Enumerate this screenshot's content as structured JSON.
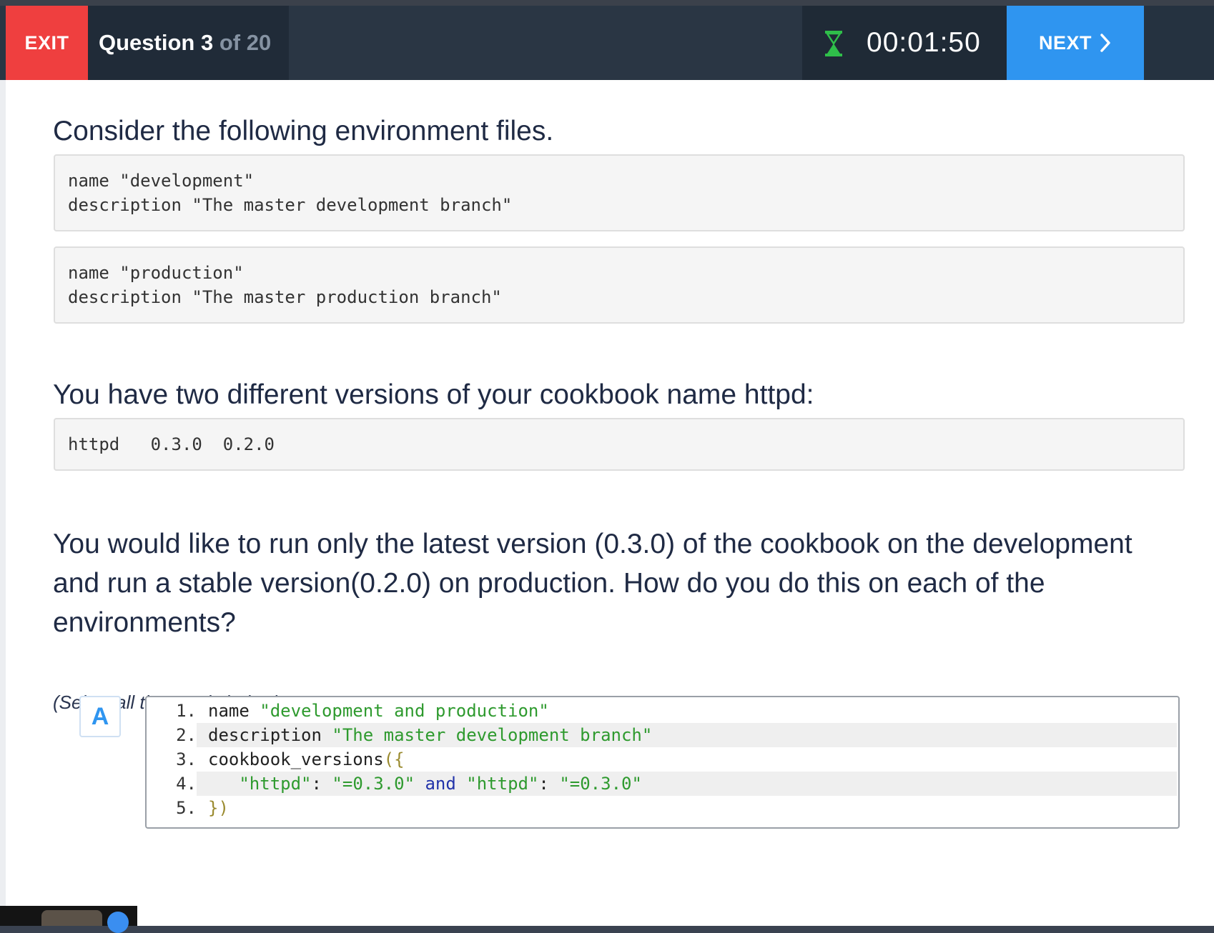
{
  "header": {
    "exit_label": "EXIT",
    "question_label": "Question 3",
    "question_of": "of 20",
    "timer": "00:01:50",
    "next_label": "NEXT",
    "icons": {
      "timer": "hourglass-icon",
      "next": "chevron-right-icon"
    },
    "colors": {
      "exit": "#ef3f3f",
      "next": "#2f95f0",
      "hourglass": "#2fbf4a"
    }
  },
  "question": {
    "intro": "Consider the following  environment files.",
    "env_files": [
      [
        "name \"development\"",
        "description \"The master development branch\""
      ],
      [
        "name \"production\"",
        "description \"The master production branch\""
      ]
    ],
    "versions_intro": "You have two different versions of your cookbook name httpd:",
    "versions_code": "httpd   0.3.0  0.2.0",
    "prompt": "You would like to run only the latest version (0.3.0) of the cookbook on the development and run a stable version(0.2.0) on production. How do you do this on each of the environments?",
    "instruction": "(Select all that apply below)"
  },
  "options": [
    {
      "letter": "A",
      "lines": [
        {
          "num": "1.",
          "pre": "name ",
          "str": "\"development and production\""
        },
        {
          "num": "2.",
          "pre": "description ",
          "str": "\"The master development branch\""
        },
        {
          "num": "3.",
          "pre": "cookbook_versions",
          "pun": "({"
        },
        {
          "num": "4.",
          "s1": "\"httpd\"",
          "p1": ": ",
          "s2": "\"=0.3.0\"",
          "kw": " and ",
          "s3": "\"httpd\"",
          "p2": ": ",
          "s4": "\"=0.3.0\""
        },
        {
          "num": "5.",
          "pun": "})"
        }
      ]
    }
  ]
}
